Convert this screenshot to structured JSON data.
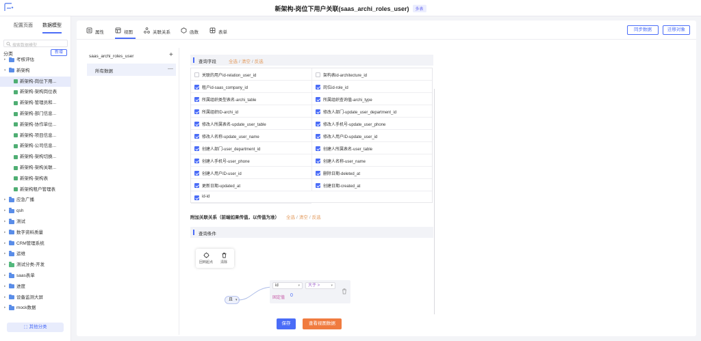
{
  "header": {
    "title": "新架构-岗位下用户关联(saas_archi_roles_user)",
    "tag": "多表"
  },
  "sidebar": {
    "tabs": [
      "配置页面",
      "数据模型"
    ],
    "search_placeholder": "搜索数据模型",
    "category_label": "分类",
    "add_label": "新增",
    "tree": [
      {
        "label": "考核评估",
        "level": 0,
        "type": "folder"
      },
      {
        "label": "新架构",
        "level": 0,
        "type": "folder",
        "expanded": true
      },
      {
        "label": "新架构-岗位下用...",
        "level": 1,
        "type": "table",
        "selected": true
      },
      {
        "label": "新架构-架构岗位表",
        "level": 1,
        "type": "table"
      },
      {
        "label": "新架构-管理员和...",
        "level": 1,
        "type": "table"
      },
      {
        "label": "新架构-部门信息...",
        "level": 1,
        "type": "table"
      },
      {
        "label": "新架构-协作单位...",
        "level": 1,
        "type": "table"
      },
      {
        "label": "新架构-项目信息...",
        "level": 1,
        "type": "table"
      },
      {
        "label": "新架构-公司信息...",
        "level": 1,
        "type": "table"
      },
      {
        "label": "新架构-架构切换...",
        "level": 1,
        "type": "table"
      },
      {
        "label": "新架构-架构关联...",
        "level": 1,
        "type": "table"
      },
      {
        "label": "新架构-架构表",
        "level": 1,
        "type": "table"
      },
      {
        "label": "新架构租户管理表",
        "level": 1,
        "type": "table"
      },
      {
        "label": "应急广播",
        "level": 0,
        "type": "folder"
      },
      {
        "label": "qsh",
        "level": 0,
        "type": "folder"
      },
      {
        "label": "测试",
        "level": 0,
        "type": "folder"
      },
      {
        "label": "数字资料质量",
        "level": 0,
        "type": "folder"
      },
      {
        "label": "CRM管理系统",
        "level": 0,
        "type": "folder"
      },
      {
        "label": "运维",
        "level": 0,
        "type": "folder"
      },
      {
        "label": "测试分类-开发",
        "level": 0,
        "type": "folder",
        "color": "green"
      },
      {
        "label": "saas表单",
        "level": 0,
        "type": "folder"
      },
      {
        "label": "进度",
        "level": 0,
        "type": "folder"
      },
      {
        "label": "设备监测大屏",
        "level": 0,
        "type": "folder"
      },
      {
        "label": "mock数据",
        "level": 0,
        "type": "folder"
      }
    ],
    "other_category": "其他分类"
  },
  "tabs": [
    {
      "label": "属性",
      "icon": "properties-icon"
    },
    {
      "label": "视图",
      "icon": "view-icon",
      "active": true
    },
    {
      "label": "关联关系",
      "icon": "relation-icon"
    },
    {
      "label": "函数",
      "icon": "function-icon"
    },
    {
      "label": "表单",
      "icon": "form-icon"
    }
  ],
  "actions": {
    "sync": "同步数据",
    "migrate": "迁移对象"
  },
  "views": {
    "model_name": "saas_archi_roles_user",
    "item": "所有数据"
  },
  "query_fields": {
    "title": "查询字段",
    "ops": [
      "全选",
      "清空",
      "反选"
    ],
    "fields": [
      {
        "label": "关联的用户id-relation_user_id",
        "checked": false
      },
      {
        "label": "架构表id-architecture_id",
        "checked": false
      },
      {
        "label": "租户id-saas_company_id",
        "checked": true
      },
      {
        "label": "岗位id-role_id",
        "checked": true
      },
      {
        "label": "所属组织类型表名-archi_table",
        "checked": true
      },
      {
        "label": "所属组织查询值-archi_type",
        "checked": true
      },
      {
        "label": "所属组织ID-archi_id",
        "checked": true
      },
      {
        "label": "修改人部门-update_user_department_id",
        "checked": true
      },
      {
        "label": "修改人所属表名-update_user_table",
        "checked": true
      },
      {
        "label": "修改人手机号-update_user_phone",
        "checked": true
      },
      {
        "label": "修改人名称-update_user_name",
        "checked": true
      },
      {
        "label": "修改人用户ID-update_user_id",
        "checked": true
      },
      {
        "label": "创建人部门-user_department_id",
        "checked": true
      },
      {
        "label": "创建人所属表名-user_table",
        "checked": true
      },
      {
        "label": "创建人手机号-user_phone",
        "checked": true
      },
      {
        "label": "创建人名称-user_name",
        "checked": true
      },
      {
        "label": "创建人用户ID-user_id",
        "checked": true
      },
      {
        "label": "删除日期-deleted_at",
        "checked": true
      },
      {
        "label": "更新日期-updated_at",
        "checked": true
      },
      {
        "label": "创建日期-created_at",
        "checked": true
      },
      {
        "label": "id-id",
        "checked": true
      }
    ]
  },
  "extra_relation": {
    "title": "附加关联关系（前端如果传值，以传值为准）",
    "ops": [
      "全选",
      "清空",
      "反选"
    ]
  },
  "query_conditions": {
    "title": "查询条件",
    "toolbar": [
      "回到起点",
      "清除"
    ],
    "root_logic": "且",
    "field": "id",
    "operator": "大于 >",
    "value_type": "固定值",
    "value": "0"
  },
  "footer": {
    "save": "保存",
    "view_data": "查看视图数据"
  },
  "colors": {
    "accent": "#4a6cf7",
    "orange": "#f07b3f"
  }
}
